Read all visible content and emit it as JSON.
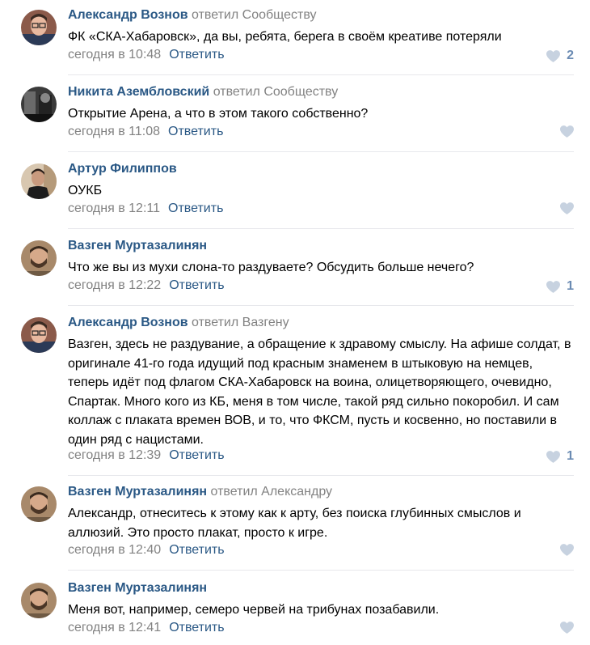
{
  "reply_label": "Ответить",
  "comments": [
    {
      "author": "Александр Вознов",
      "replied": "ответил Сообществу",
      "text": "ФК «СКА-Хабаровск», да вы, ребята, берега в своём креативе потеряли",
      "time": "сегодня в 10:48",
      "likes": "2",
      "avatar_icon": "avatar-man-glasses"
    },
    {
      "author": "Никита Азембловский",
      "replied": "ответил Сообществу",
      "text": "Открытие Арена, а что в этом такого собственно?",
      "time": "сегодня в 11:08",
      "likes": "",
      "avatar_icon": "avatar-dark-photo"
    },
    {
      "author": "Артур Филиппов",
      "replied": "",
      "text": "ОУКБ",
      "time": "сегодня в 12:11",
      "likes": "",
      "avatar_icon": "avatar-man-dark-jacket"
    },
    {
      "author": "Вазген Муртазалинян",
      "replied": "",
      "text": "Что же вы из мухи слона-то раздуваете? Обсудить больше нечего?",
      "time": "сегодня в 12:22",
      "likes": "1",
      "avatar_icon": "avatar-man-beard"
    },
    {
      "author": "Александр Вознов",
      "replied": "ответил Вазгену",
      "text": "Вазген, здесь не раздувание, а обращение к здравому смыслу. На афише солдат, в оригинале 41-го года идущий под красным знаменем в штыковую на немцев, теперь идёт под флагом СКА-Хабаровск на воина, олицетворяющего, очевидно, Спартак. Много кого из КБ, меня в том числе, такой ряд сильно покоробил. И сам коллаж с плаката времен ВОВ, и то, что ФКСМ, пусть и косвенно, но поставили в один ряд с нацистами.",
      "time": "сегодня в 12:39",
      "likes": "1",
      "avatar_icon": "avatar-man-glasses"
    },
    {
      "author": "Вазген Муртазалинян",
      "replied": "ответил Александру",
      "text": "Александр, отнеситесь к этому как к арту, без поиска глубинных смыслов и аллюзий. Это просто плакат, просто к игре.",
      "time": "сегодня в 12:40",
      "likes": "",
      "avatar_icon": "avatar-man-beard"
    },
    {
      "author": "Вазген Муртазалинян",
      "replied": "",
      "text": "Меня вот, например, семеро червей на трибунах позабавили.",
      "time": "сегодня в 12:41",
      "likes": "",
      "avatar_icon": "avatar-man-beard"
    }
  ]
}
